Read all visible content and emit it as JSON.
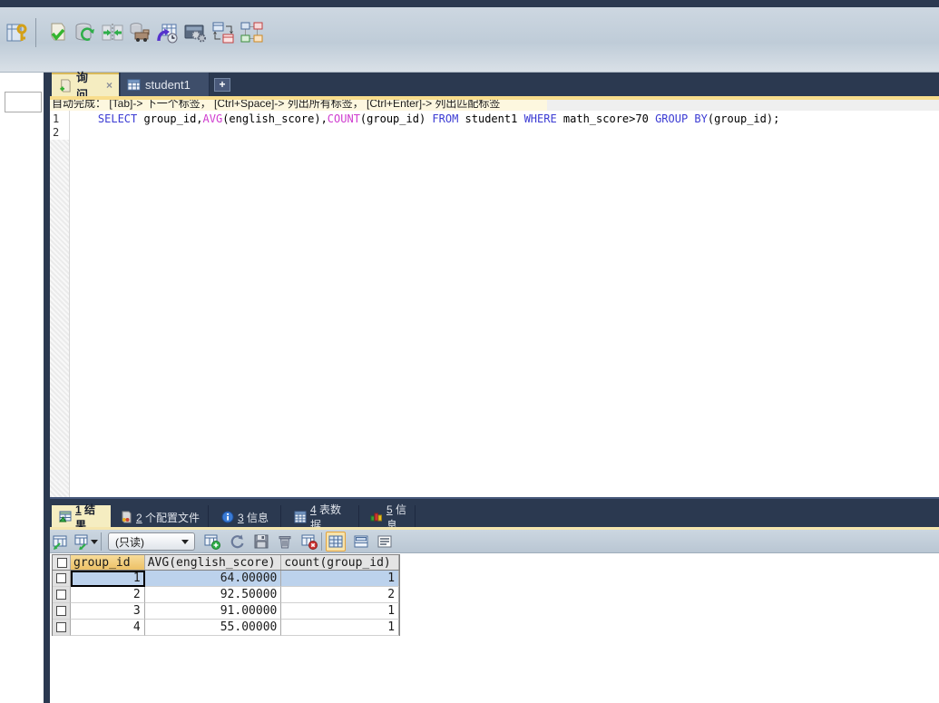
{
  "colors": {
    "accent_navy": "#2b3950",
    "active_tab_bg": "#f5edc1",
    "hint_yellow": "#f8dd8c",
    "selected_row": "#bcd2ec",
    "sorted_header": "#edc166",
    "sql_keyword": "#3b3bd3",
    "sql_function": "#cf3ccf"
  },
  "toolbar": {
    "icons": [
      "new-connection",
      "execute-script",
      "refresh-database",
      "data-compare",
      "backup-database",
      "import-external-data",
      "job-scheduler",
      "schema-sync",
      "schema-designer"
    ]
  },
  "query_tabs": {
    "query": {
      "label": "询问",
      "close_label": "×"
    },
    "table": {
      "label": "student1"
    },
    "new_tab_label": "+"
  },
  "hint_bar": {
    "text": "自动完成： [Tab]-> 下一个标签， [Ctrl+Space]-> 列出所有标签， [Ctrl+Enter]-> 列出匹配标签"
  },
  "editor": {
    "line_numbers": [
      "1",
      "2"
    ],
    "sql_tokens": [
      {
        "text": "    ",
        "type": "plain"
      },
      {
        "text": "SELECT",
        "type": "keyword"
      },
      {
        "text": " group_id,",
        "type": "plain"
      },
      {
        "text": "AVG",
        "type": "function"
      },
      {
        "text": "(english_score),",
        "type": "plain"
      },
      {
        "text": "COUNT",
        "type": "function"
      },
      {
        "text": "(group_id) ",
        "type": "plain"
      },
      {
        "text": "FROM",
        "type": "keyword"
      },
      {
        "text": " student1 ",
        "type": "plain"
      },
      {
        "text": "WHERE",
        "type": "keyword"
      },
      {
        "text": " math_score>70 ",
        "type": "plain"
      },
      {
        "text": "GROUP BY",
        "type": "keyword"
      },
      {
        "text": "(group_id);",
        "type": "plain"
      }
    ]
  },
  "results": {
    "tabs": [
      {
        "num": "1",
        "label": "结果"
      },
      {
        "num": "2",
        "label": "个配置文件"
      },
      {
        "num": "3",
        "label": "信息"
      },
      {
        "num": "4",
        "label": "表数据"
      },
      {
        "num": "5",
        "label": "信息"
      }
    ],
    "toolbar": {
      "readonly_mode": "(只读)"
    },
    "grid": {
      "columns": [
        "group_id",
        "AVG(english_score)",
        "count(group_id)"
      ],
      "rows": [
        [
          "1",
          "64.00000",
          "1"
        ],
        [
          "2",
          "92.50000",
          "2"
        ],
        [
          "3",
          "91.00000",
          "1"
        ],
        [
          "4",
          "55.00000",
          "1"
        ]
      ]
    }
  }
}
